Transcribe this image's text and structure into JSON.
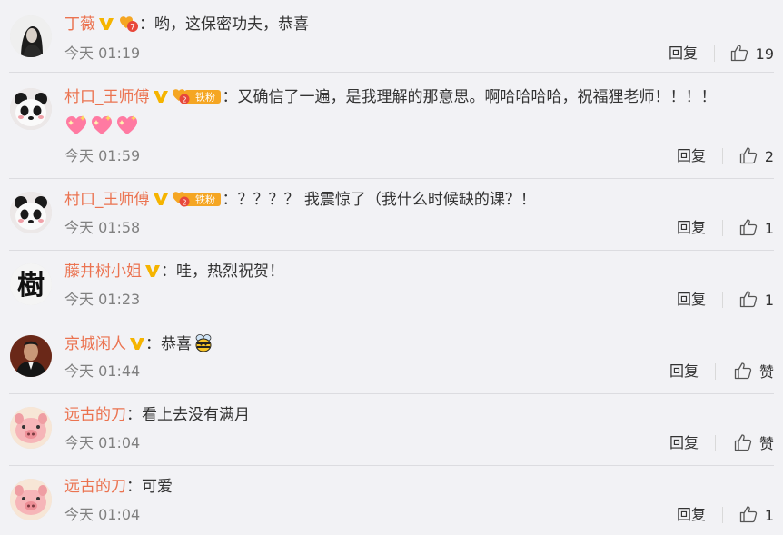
{
  "comments": [
    {
      "user": "丁薇",
      "badges": [
        "verified-v",
        "heart-badge"
      ],
      "text": "：哟，这保密功夫，恭喜",
      "time": "今天 01:19",
      "reply": "回复",
      "likes": "19",
      "avatar": "woman-portrait-avatar"
    },
    {
      "user": "村口_王师傅",
      "badges": [
        "verified-v",
        "fan-badge"
      ],
      "fan_label": "铁粉",
      "text": "：又确信了一遍，是我理解的那意思。啊哈哈哈哈，祝福狸老师！！！！",
      "emojis": [
        "heart-sparkle-emoji",
        "heart-sparkle-emoji",
        "heart-sparkle-emoji"
      ],
      "time": "今天 01:59",
      "reply": "回复",
      "likes": "2",
      "avatar": "panda-avatar"
    },
    {
      "user": "村口_王师傅",
      "badges": [
        "verified-v",
        "fan-badge"
      ],
      "fan_label": "铁粉",
      "text": "：？？？？ 我震惊了（我什么时候缺的课？！",
      "time": "今天 01:58",
      "reply": "回复",
      "likes": "1",
      "avatar": "panda-avatar"
    },
    {
      "user": "藤井树小姐",
      "badges": [
        "verified-v"
      ],
      "text": "：哇，热烈祝贺！",
      "time": "今天 01:23",
      "reply": "回复",
      "likes": "1",
      "avatar": "calligraphy-avatar"
    },
    {
      "user": "京城闲人",
      "badges": [
        "verified-v"
      ],
      "text": "：恭喜",
      "trailing_emoji": "bee-emoji",
      "time": "今天 01:44",
      "reply": "回复",
      "likes": "赞",
      "avatar": "man-suit-avatar"
    },
    {
      "user": "远古的刀",
      "badges": [],
      "text": "：看上去没有满月",
      "time": "今天 01:04",
      "reply": "回复",
      "likes": "赞",
      "avatar": "pink-pig-avatar"
    },
    {
      "user": "远古的刀",
      "badges": [],
      "text": "：可爱",
      "time": "今天 01:04",
      "reply": "回复",
      "likes": "1",
      "avatar": "pink-pig-avatar"
    }
  ],
  "colors": {
    "username": "#eb7350",
    "background": "#f2f2f5",
    "time": "#808080",
    "verified": "#f5b400"
  }
}
